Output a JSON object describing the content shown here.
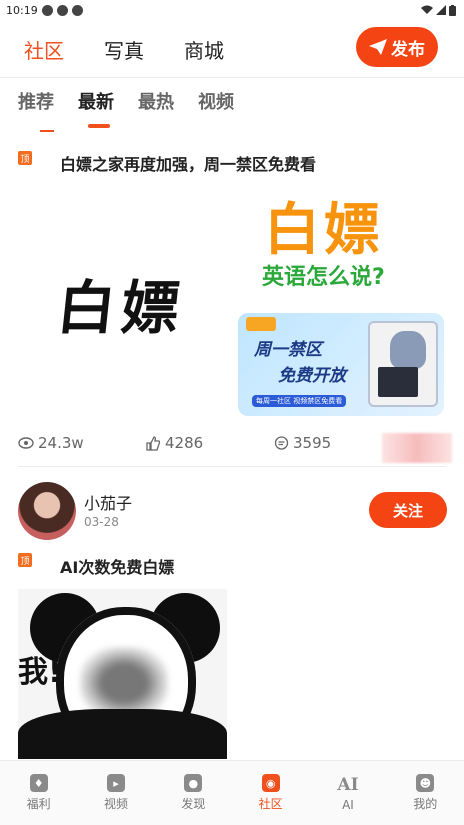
{
  "status": {
    "time": "10:19"
  },
  "topnav": {
    "tabs": [
      "社区",
      "写真",
      "商城"
    ],
    "publish_label": "发布"
  },
  "subtabs": [
    "推荐",
    "最新",
    "最热",
    "视频"
  ],
  "post1": {
    "pin_label": "顶",
    "title": "白嫖之家再度加强，周一禁区免费看",
    "image_left_text": "白嫖",
    "image_right_title": "白嫖",
    "image_right_question": "英语怎么说?",
    "promo_line1": "周一禁区",
    "promo_line2": "免费开放",
    "promo_footer": "每周一社区  视频禁区免费看",
    "views": "24.3w",
    "likes": "4286",
    "comments": "3595"
  },
  "post2": {
    "author": "小茄子",
    "date": "03-28",
    "follow_label": "关注",
    "pin_label": "顶",
    "title": "AI次数免费白嫖",
    "image_text": "我!"
  },
  "bottomnav": [
    "福利",
    "视频",
    "发现",
    "社区",
    "AI",
    "我的"
  ],
  "colors": {
    "accent": "#f54414"
  }
}
